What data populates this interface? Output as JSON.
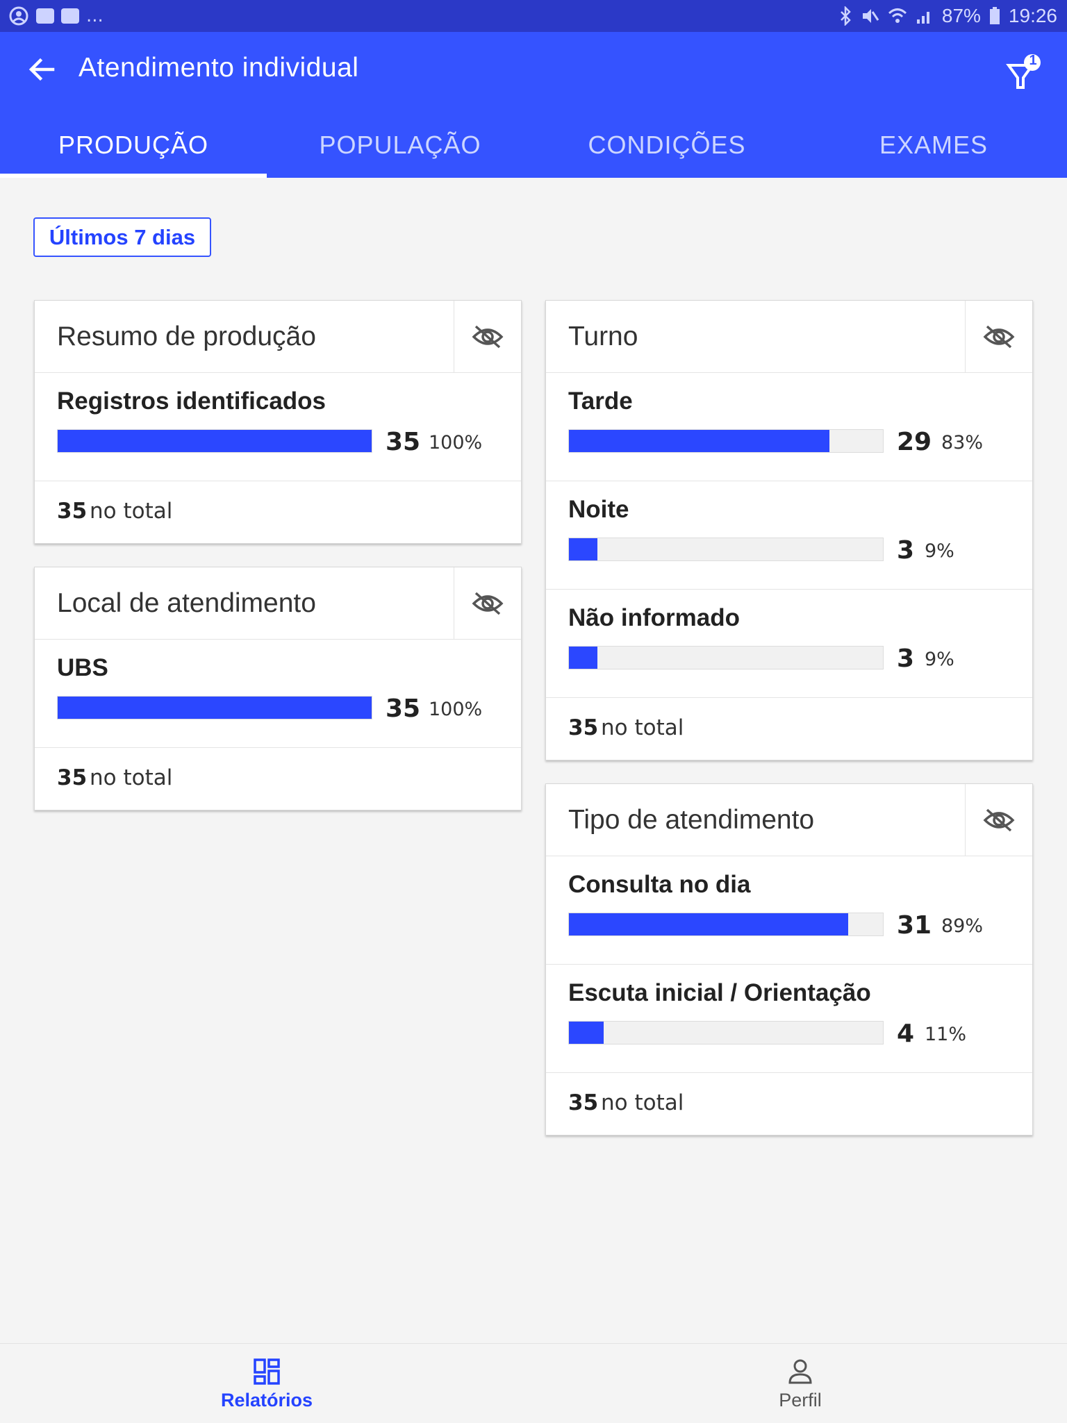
{
  "status_bar": {
    "battery": "87%",
    "time": "19:26",
    "dots": "..."
  },
  "app_bar": {
    "title": "Atendimento individual",
    "filter_badge": "1"
  },
  "tabs": [
    {
      "label": "PRODUÇÃO",
      "active": true
    },
    {
      "label": "POPULAÇÃO",
      "active": false
    },
    {
      "label": "CONDIÇÕES",
      "active": false
    },
    {
      "label": "EXAMES",
      "active": false
    }
  ],
  "period_chip": "Últimos 7 dias",
  "cards": {
    "resumo": {
      "title": "Resumo de produção",
      "rows": [
        {
          "label": "Registros identificados",
          "count": "35",
          "percent": "100%",
          "fraction": 1.0
        }
      ],
      "total_num": "35",
      "total_text": "no total"
    },
    "local": {
      "title": "Local de atendimento",
      "rows": [
        {
          "label": "UBS",
          "count": "35",
          "percent": "100%",
          "fraction": 1.0
        }
      ],
      "total_num": "35",
      "total_text": "no total"
    },
    "turno": {
      "title": "Turno",
      "rows": [
        {
          "label": "Tarde",
          "count": "29",
          "percent": "83%",
          "fraction": 0.83
        },
        {
          "label": "Noite",
          "count": "3",
          "percent": "9%",
          "fraction": 0.09
        },
        {
          "label": "Não informado",
          "count": "3",
          "percent": "9%",
          "fraction": 0.09
        }
      ],
      "total_num": "35",
      "total_text": "no total"
    },
    "tipo": {
      "title": "Tipo de atendimento",
      "rows": [
        {
          "label": "Consulta no dia",
          "count": "31",
          "percent": "89%",
          "fraction": 0.89
        },
        {
          "label": "Escuta inicial / Orientação",
          "count": "4",
          "percent": "11%",
          "fraction": 0.11
        }
      ],
      "total_num": "35",
      "total_text": "no total"
    }
  },
  "bottom_nav": [
    {
      "label": "Relatórios",
      "icon": "dashboard-icon",
      "active": true
    },
    {
      "label": "Perfil",
      "icon": "person-icon",
      "active": false
    }
  ],
  "colors": {
    "primary": "#3553ff",
    "bar": "#2b47ff",
    "status_bar": "#2b39c7"
  }
}
